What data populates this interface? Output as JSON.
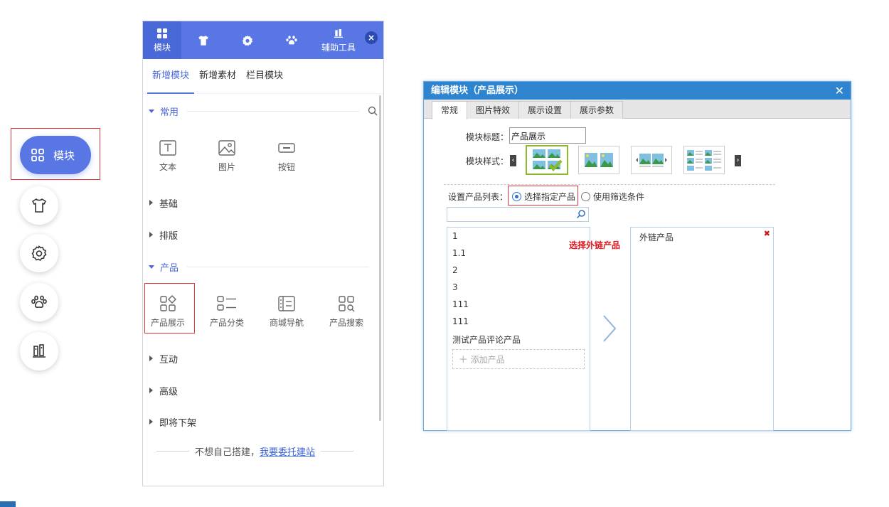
{
  "side_buttons": {
    "module_label": "模块",
    "icons": [
      "grid-icon",
      "tshirt-icon",
      "gear-icon",
      "paw-icon",
      "tools-icon"
    ]
  },
  "panel": {
    "top_tabs": [
      {
        "label": "模块",
        "icon": "grid-icon",
        "active": true
      },
      {
        "label": "",
        "icon": "tshirt-icon"
      },
      {
        "label": "",
        "icon": "gear-icon"
      },
      {
        "label": "",
        "icon": "paw-icon"
      },
      {
        "label": "辅助工具",
        "icon": "tools-icon"
      }
    ],
    "close_label": "×",
    "sub_tabs": [
      "新增模块",
      "新增素材",
      "栏目模块"
    ],
    "sections": {
      "common": {
        "title": "常用",
        "items": [
          "文本",
          "图片",
          "按钮"
        ]
      },
      "basic": {
        "title": "基础"
      },
      "layout": {
        "title": "排版"
      },
      "product": {
        "title": "产品",
        "items": [
          "产品展示",
          "产品分类",
          "商城导航",
          "产品搜索"
        ]
      },
      "interactive": {
        "title": "互动"
      },
      "advanced": {
        "title": "高级"
      },
      "deprecated": {
        "title": "即将下架"
      }
    },
    "footer_text": "不想自己搭建，",
    "footer_link": "我要委托建站"
  },
  "dialog": {
    "title": "编辑模块（产品展示）",
    "close": "✕",
    "tabs": [
      "常规",
      "图片特效",
      "展示设置",
      "展示参数"
    ],
    "module_title_label": "模块标题：",
    "module_title_value": "产品展示",
    "module_style_label": "模块样式：",
    "product_list_label": "设置产品列表：",
    "radio_selected": "选择指定产品",
    "radio_filter": "使用筛选条件",
    "products": [
      "1",
      "1.1",
      "2",
      "3",
      "111",
      "111",
      "测试产品评论产品"
    ],
    "add_product": "添加产品",
    "select_note": "选择外链产品",
    "external_title": "外链产品",
    "remove_mark": "✖",
    "accent": "#2e84cf"
  },
  "colors": {
    "brand": "#5877e5",
    "highlight": "#e0353a",
    "note": "#e0191f"
  }
}
